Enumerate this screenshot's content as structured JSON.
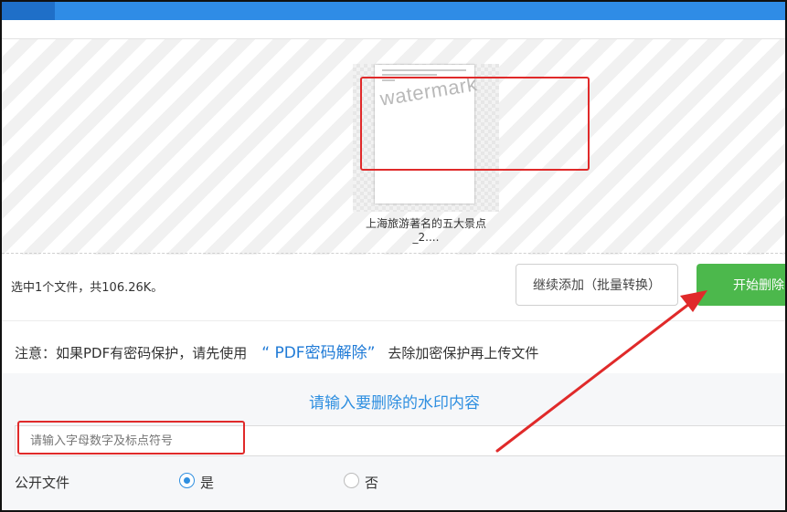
{
  "upload": {
    "filename": "上海旅游著名的五大景点_2....",
    "watermark_text": "watermark"
  },
  "status": {
    "selection_info": "选中1个文件，共106.26K。"
  },
  "buttons": {
    "continue_add": "继续添加（批量转换）",
    "start_delete": "开始删除"
  },
  "notice": {
    "prefix": "注意：如果PDF有密码保护，请先使用",
    "link": "“ PDF密码解除”",
    "suffix": "去除加密保护再上传文件"
  },
  "form": {
    "title": "请输入要删除的水印内容",
    "watermark_input_placeholder": "请输入字母数字及标点符号",
    "public_label": "公开文件",
    "option_yes": "是",
    "option_no": "否",
    "selected": "是"
  },
  "colors": {
    "accent_blue": "#2f8ce6",
    "start_green": "#4cb84c",
    "annotation_red": "#e02a2a"
  }
}
